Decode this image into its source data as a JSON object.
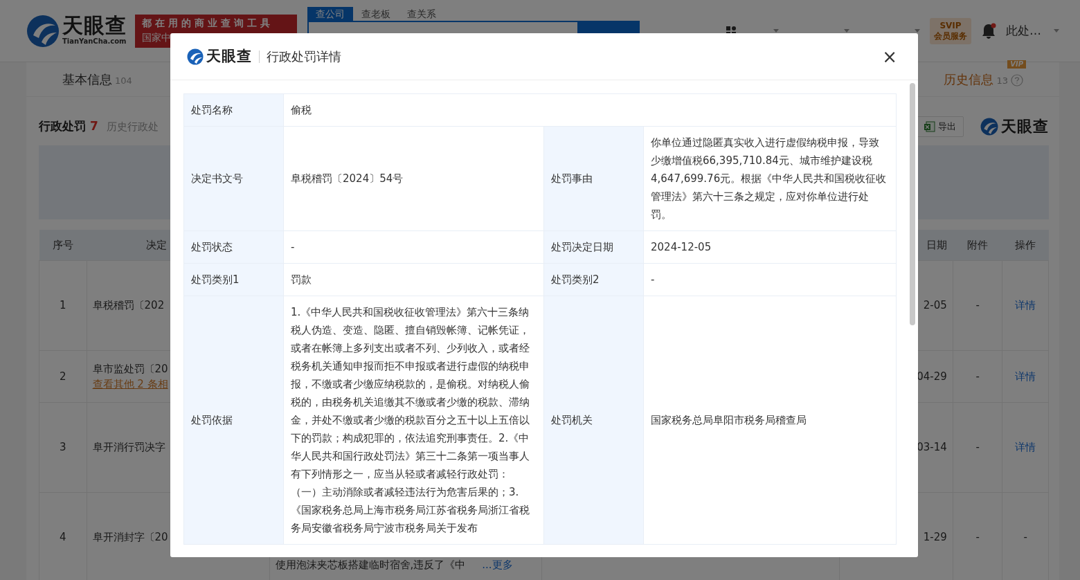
{
  "header": {
    "logo_text": "天眼查",
    "logo_sub": "TianYanCha.com",
    "slogan": [
      "都在用的商业查询工具",
      "国家中"
    ],
    "search_tabs": [
      {
        "label": "查公司",
        "selected": true
      },
      {
        "label": "查老板",
        "selected": false
      },
      {
        "label": "查关系",
        "selected": false
      }
    ],
    "svip": {
      "badge": "SVIP",
      "label": "会员服务"
    },
    "notification_dot": true,
    "user": "此处…"
  },
  "page_tabs": [
    {
      "label": "基本信息",
      "count": "104"
    },
    {
      "label": "历史信息",
      "count": "13",
      "vip": "VIP"
    }
  ],
  "section": {
    "title": "行政处罚",
    "count": "7",
    "subtitle": "历史行政处",
    "export": "导出",
    "logo_text": "天眼查"
  },
  "table": {
    "columns": [
      "序号",
      "决定",
      "日期",
      "附件",
      "操作"
    ],
    "rows": [
      {
        "index": "1",
        "decision": "阜税稽罚〔202",
        "date": "2-05",
        "attachment": "-",
        "action": "详情"
      },
      {
        "index": "2",
        "decision": "阜市监处罚〔20",
        "related": "查看其他 2 条相",
        "date": "04-29",
        "attachment": "-",
        "action": "详情"
      },
      {
        "index": "3",
        "decision": "阜开消行罚决字",
        "date": "03-14",
        "attachment": "-",
        "action": "详情"
      },
      {
        "index": "4",
        "decision": "阜开消封字〔20",
        "reason": "使用泡沫夹芯板搭建临时宿舍,违反了《中",
        "reason_more": "...更多",
        "date": "1-29",
        "attachment": "-",
        "action": "-"
      }
    ]
  },
  "modal": {
    "logo_text": "天眼查",
    "title": "行政处罚详情",
    "close": "×",
    "rows": [
      {
        "fields": [
          {
            "label": "处罚名称",
            "value": "偷税"
          }
        ]
      },
      {
        "fields": [
          {
            "label": "决定书文号",
            "value": "阜税稽罚〔2024〕54号"
          },
          {
            "label": "处罚事由",
            "value": "你单位通过隐匿真实收入进行虚假纳税申报，导致少缴增值税66,395,710.84元、城市维护建设税4,647,699.76元。根据《中华人民共和国税收征收管理法》第六十三条之规定，应对你单位进行处罚。"
          }
        ]
      },
      {
        "fields": [
          {
            "label": "处罚状态",
            "value": "-"
          },
          {
            "label": "处罚决定日期",
            "value": "2024-12-05"
          }
        ]
      },
      {
        "fields": [
          {
            "label": "处罚类别1",
            "value": "罚款"
          },
          {
            "label": "处罚类别2",
            "value": "-"
          }
        ]
      },
      {
        "fields": [
          {
            "label": "处罚依据",
            "value": "1.《中华人民共和国税收征收管理法》第六十三条纳税人伪造、变造、隐匿、擅自销毁帐簿、记帐凭证，或者在帐簿上多列支出或者不列、少列收入，或者经税务机关通知申报而拒不申报或者进行虚假的纳税申报，不缴或者少缴应纳税款的，是偷税。对纳税人偷税的，由税务机关追缴其不缴或者少缴的税款、滞纳金，并处不缴或者少缴的税款百分之五十以上五倍以下的罚款；构成犯罪的，依法追究刑事责任。2.《中华人民共和国行政处罚法》第三十二条第一项当事人有下列情形之一，应当从轻或者减轻行政处罚：（一）主动消除或者减轻违法行为危害后果的；3.《国家税务总局上海市税务局江苏省税务局浙江省税务局安徽省税务局宁波市税务局关于发布"
          },
          {
            "label": "处罚机关",
            "value": "国家税务总局阜阳市税务局稽查局"
          }
        ]
      }
    ]
  }
}
